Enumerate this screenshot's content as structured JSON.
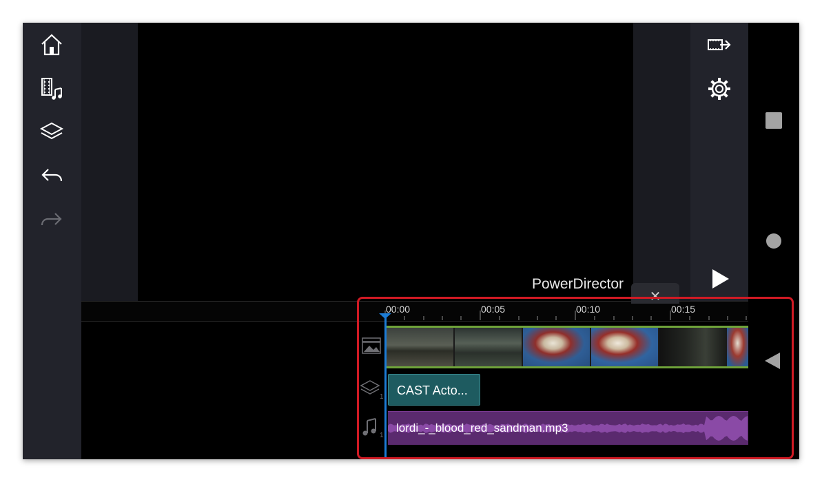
{
  "app": {
    "name": "PowerDirector"
  },
  "left_toolbar": {
    "items": [
      {
        "id": "home",
        "icon": "home-icon"
      },
      {
        "id": "media",
        "icon": "media-music-icon"
      },
      {
        "id": "layers",
        "icon": "layers-icon"
      },
      {
        "id": "undo",
        "icon": "undo-icon"
      },
      {
        "id": "redo",
        "icon": "redo-icon",
        "disabled": true
      }
    ]
  },
  "right_toolbar": {
    "items": [
      {
        "id": "produce",
        "icon": "export-video-icon"
      },
      {
        "id": "settings",
        "icon": "gear-icon"
      },
      {
        "id": "play",
        "icon": "play-icon"
      }
    ]
  },
  "android_nav": {
    "items": [
      {
        "id": "recents",
        "icon": "square-icon"
      },
      {
        "id": "home",
        "icon": "circle-icon"
      },
      {
        "id": "back",
        "icon": "triangle-back-icon"
      }
    ]
  },
  "timeline": {
    "ruler": [
      "00:00",
      "00:05",
      "00:10",
      "00:15"
    ],
    "collapse_glyph": "✕",
    "overlay_track": {
      "clip_label": "CAST Acto...",
      "track_number": "1"
    },
    "audio_track": {
      "clip_label": "lordi_-_blood_red_sandman.mp3",
      "track_number": "1"
    }
  },
  "colors": {
    "accent_playhead": "#1c7cd6",
    "video_clip_border": "#6fa33a",
    "overlay_clip": "#1e5b60",
    "audio_clip": "#5a2a6e",
    "highlight_frame": "#d11a24"
  }
}
